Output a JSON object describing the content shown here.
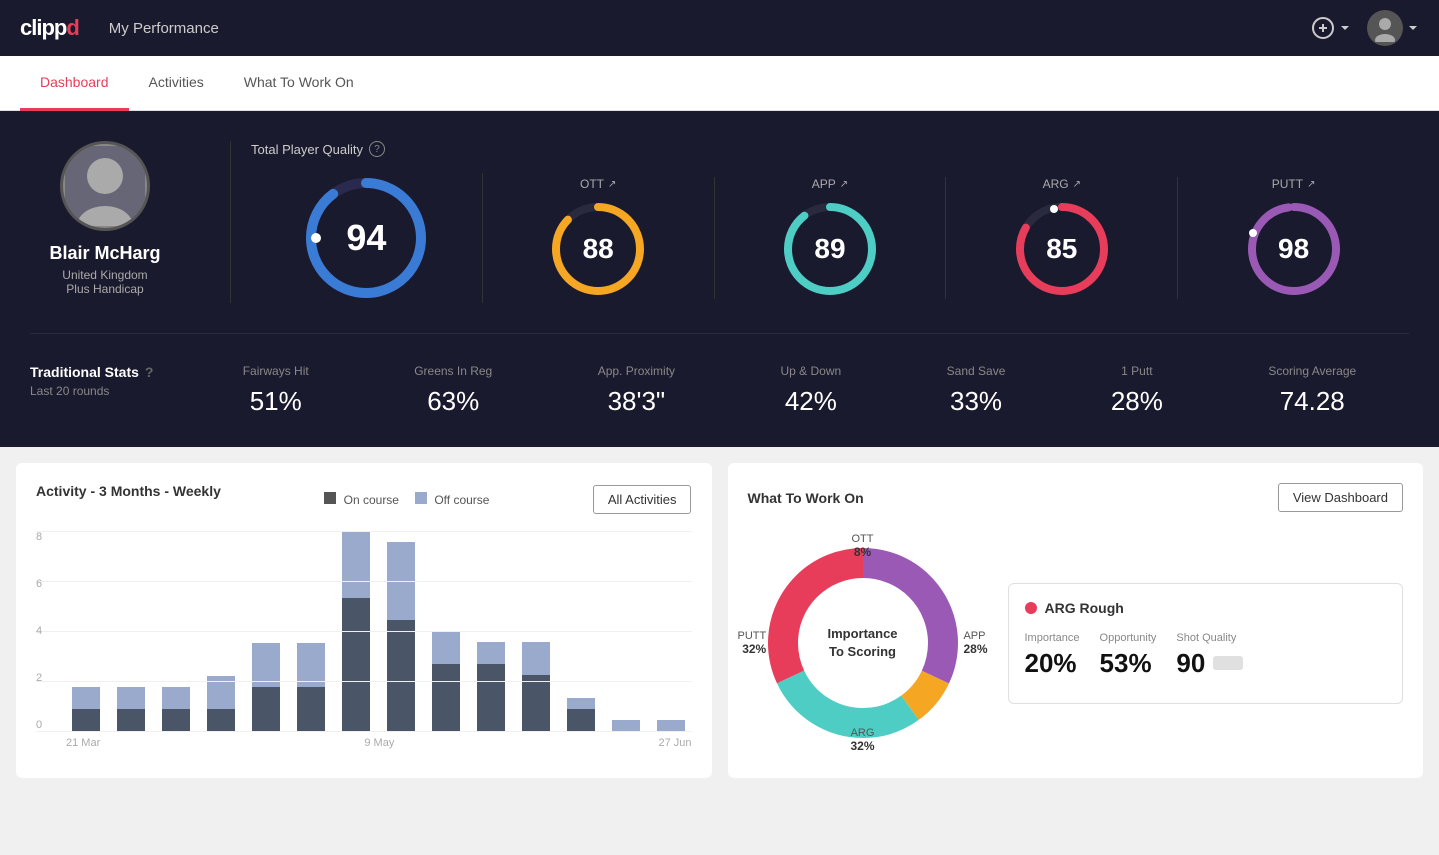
{
  "app": {
    "logo": "clippd",
    "nav_title": "My Performance"
  },
  "tabs": [
    {
      "label": "Dashboard",
      "active": true
    },
    {
      "label": "Activities",
      "active": false
    },
    {
      "label": "What To Work On",
      "active": false
    }
  ],
  "player": {
    "name": "Blair McHarg",
    "country": "United Kingdom",
    "handicap": "Plus Handicap"
  },
  "quality": {
    "label": "Total Player Quality",
    "total": "94",
    "metrics": [
      {
        "key": "OTT",
        "value": "88",
        "color": "#f5a623",
        "trend": "↗"
      },
      {
        "key": "APP",
        "value": "89",
        "color": "#4ecdc4",
        "trend": "↗"
      },
      {
        "key": "ARG",
        "value": "85",
        "color": "#e83d5a",
        "trend": "↗"
      },
      {
        "key": "PUTT",
        "value": "98",
        "color": "#9b59b6",
        "trend": "↗"
      }
    ]
  },
  "traditional_stats": {
    "title": "Traditional Stats",
    "subtitle": "Last 20 rounds",
    "items": [
      {
        "label": "Fairways Hit",
        "value": "51%"
      },
      {
        "label": "Greens In Reg",
        "value": "63%"
      },
      {
        "label": "App. Proximity",
        "value": "38'3\""
      },
      {
        "label": "Up & Down",
        "value": "42%"
      },
      {
        "label": "Sand Save",
        "value": "33%"
      },
      {
        "label": "1 Putt",
        "value": "28%"
      },
      {
        "label": "Scoring Average",
        "value": "74.28"
      }
    ]
  },
  "activity_chart": {
    "title": "Activity - 3 Months - Weekly",
    "legend": [
      {
        "label": "On course",
        "color": "#555"
      },
      {
        "label": "Off course",
        "color": "#99aacc"
      }
    ],
    "all_activities_label": "All Activities",
    "x_labels": [
      "21 Mar",
      "9 May",
      "27 Jun"
    ],
    "y_labels": [
      "8",
      "6",
      "4",
      "2",
      "0"
    ],
    "bars": [
      {
        "on": 1,
        "off": 1
      },
      {
        "on": 1,
        "off": 1
      },
      {
        "on": 1,
        "off": 1
      },
      {
        "on": 1,
        "off": 1.5
      },
      {
        "on": 2,
        "off": 2
      },
      {
        "on": 2,
        "off": 2
      },
      {
        "on": 6,
        "off": 3
      },
      {
        "on": 5,
        "off": 3.5
      },
      {
        "on": 3,
        "off": 1.5
      },
      {
        "on": 3,
        "off": 1
      },
      {
        "on": 2.5,
        "off": 1.5
      },
      {
        "on": 1,
        "off": 0.5
      },
      {
        "on": 0,
        "off": 0.5
      },
      {
        "on": 0,
        "off": 0.5
      }
    ]
  },
  "what_to_work_on": {
    "title": "What To Work On",
    "view_dashboard_label": "View Dashboard",
    "donut": {
      "center_text": "Importance\nTo Scoring",
      "segments": [
        {
          "label": "OTT",
          "pct": "8%",
          "color": "#f5a623"
        },
        {
          "label": "APP",
          "pct": "28%",
          "color": "#4ecdc4"
        },
        {
          "label": "ARG",
          "pct": "32%",
          "color": "#e83d5a"
        },
        {
          "label": "PUTT",
          "pct": "32%",
          "color": "#9b59b6"
        }
      ]
    },
    "card": {
      "title": "ARG Rough",
      "dot_color": "#e83d5a",
      "metrics": [
        {
          "label": "Importance",
          "value": "20%"
        },
        {
          "label": "Opportunity",
          "value": "53%"
        },
        {
          "label": "Shot Quality",
          "value": "90"
        }
      ]
    }
  }
}
